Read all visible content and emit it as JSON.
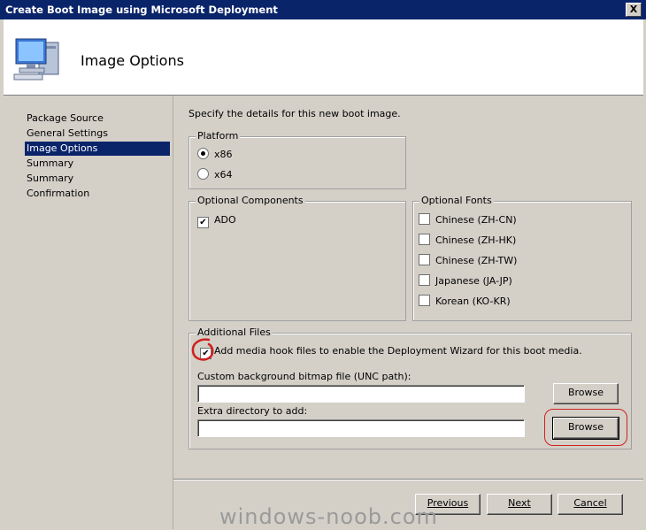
{
  "window": {
    "title": "Create Boot Image using Microsoft Deployment",
    "close_label": "X"
  },
  "header": {
    "title": "Image Options",
    "icon": "computer-icon"
  },
  "nav": {
    "items": [
      {
        "label": "Package Source",
        "selected": false
      },
      {
        "label": "General Settings",
        "selected": false
      },
      {
        "label": "Image Options",
        "selected": true
      },
      {
        "label": "Summary",
        "selected": false
      },
      {
        "label": "Summary",
        "selected": false
      },
      {
        "label": "Confirmation",
        "selected": false
      }
    ]
  },
  "main": {
    "intro": "Specify the details for this new boot image.",
    "platform": {
      "legend": "Platform",
      "options": [
        {
          "label": "x86",
          "selected": true
        },
        {
          "label": "x64",
          "selected": false
        }
      ]
    },
    "optional_components": {
      "legend": "Optional Components",
      "items": [
        {
          "label": "ADO",
          "checked": true
        }
      ]
    },
    "optional_fonts": {
      "legend": "Optional Fonts",
      "items": [
        {
          "label": "Chinese (ZH-CN)",
          "checked": false
        },
        {
          "label": "Chinese (ZH-HK)",
          "checked": false
        },
        {
          "label": "Chinese (ZH-TW)",
          "checked": false
        },
        {
          "label": "Japanese (JA-JP)",
          "checked": false
        },
        {
          "label": "Korean (KO-KR)",
          "checked": false
        }
      ]
    },
    "additional_files": {
      "legend": "Additional Files",
      "media_hook_label": "Add media hook files to enable the Deployment Wizard for this boot media.",
      "media_hook_checked": true,
      "bg_label": "Custom background bitmap file (UNC path):",
      "bg_value": "",
      "extra_label": "Extra directory to add:",
      "extra_value": "",
      "browse_label": "Browse"
    }
  },
  "footer": {
    "previous_label": "Previous",
    "next_label": "Next",
    "cancel_label": "Cancel"
  },
  "watermark": "windows-noob.com",
  "colors": {
    "titlebar": "#0a246a",
    "selection": "#0a246a",
    "annotation": "#d02020"
  }
}
